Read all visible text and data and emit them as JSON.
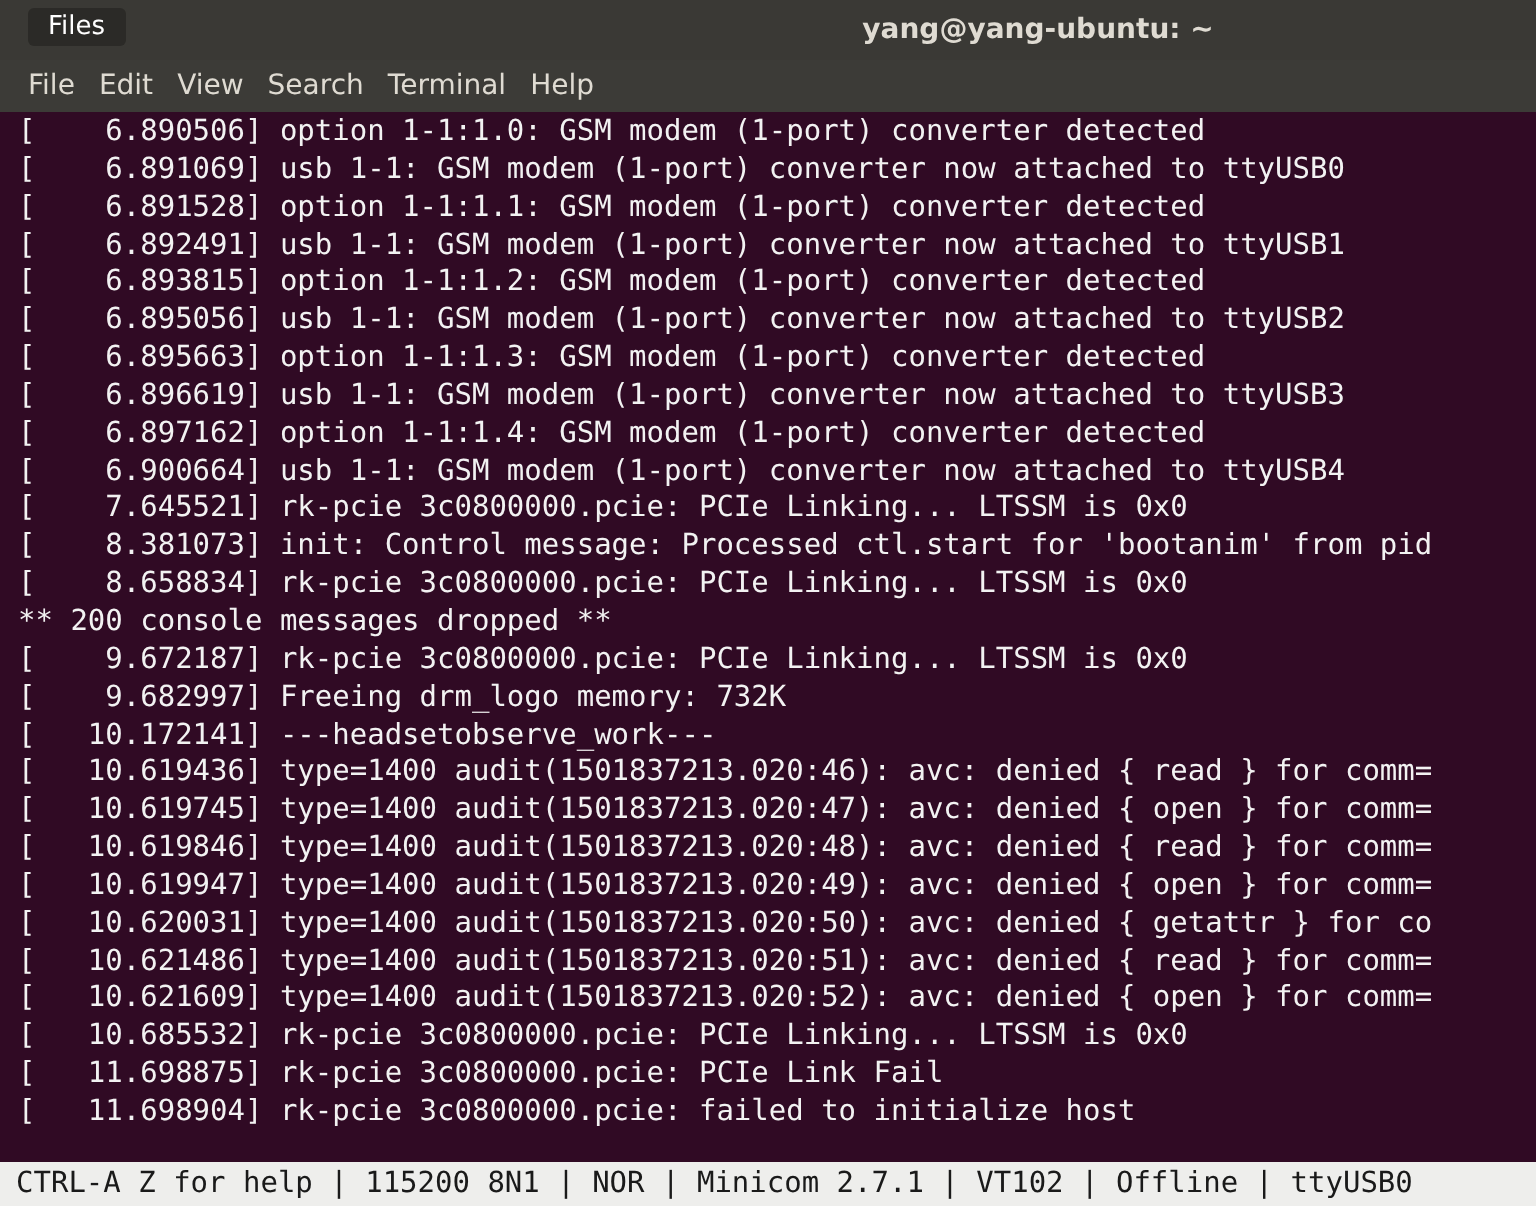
{
  "window": {
    "title": "yang@yang-ubuntu: ~"
  },
  "menu": [
    "File",
    "Edit",
    "View",
    "Search",
    "Terminal",
    "Help"
  ],
  "tooltip": "Files",
  "terminal_lines": [
    "[    6.890506] option 1-1:1.0: GSM modem (1-port) converter detected",
    "[    6.891069] usb 1-1: GSM modem (1-port) converter now attached to ttyUSB0",
    "[    6.891528] option 1-1:1.1: GSM modem (1-port) converter detected",
    "[    6.892491] usb 1-1: GSM modem (1-port) converter now attached to ttyUSB1",
    "[    6.893815] option 1-1:1.2: GSM modem (1-port) converter detected",
    "[    6.895056] usb 1-1: GSM modem (1-port) converter now attached to ttyUSB2",
    "[    6.895663] option 1-1:1.3: GSM modem (1-port) converter detected",
    "[    6.896619] usb 1-1: GSM modem (1-port) converter now attached to ttyUSB3",
    "[    6.897162] option 1-1:1.4: GSM modem (1-port) converter detected",
    "[    6.900664] usb 1-1: GSM modem (1-port) converter now attached to ttyUSB4",
    "[    7.645521] rk-pcie 3c0800000.pcie: PCIe Linking... LTSSM is 0x0",
    "[    8.381073] init: Control message: Processed ctl.start for 'bootanim' from pid",
    "[    8.658834] rk-pcie 3c0800000.pcie: PCIe Linking... LTSSM is 0x0",
    "** 200 console messages dropped **",
    "[    9.672187] rk-pcie 3c0800000.pcie: PCIe Linking... LTSSM is 0x0",
    "[    9.682997] Freeing drm_logo memory: 732K",
    "[   10.172141] ---headsetobserve_work---",
    "[   10.619436] type=1400 audit(1501837213.020:46): avc: denied { read } for comm=",
    "[   10.619745] type=1400 audit(1501837213.020:47): avc: denied { open } for comm=",
    "[   10.619846] type=1400 audit(1501837213.020:48): avc: denied { read } for comm=",
    "[   10.619947] type=1400 audit(1501837213.020:49): avc: denied { open } for comm=",
    "[   10.620031] type=1400 audit(1501837213.020:50): avc: denied { getattr } for co",
    "[   10.621486] type=1400 audit(1501837213.020:51): avc: denied { read } for comm=",
    "[   10.621609] type=1400 audit(1501837213.020:52): avc: denied { open } for comm=",
    "[   10.685532] rk-pcie 3c0800000.pcie: PCIe Linking... LTSSM is 0x0",
    "[   11.698875] rk-pcie 3c0800000.pcie: PCIe Link Fail",
    "[   11.698904] rk-pcie 3c0800000.pcie: failed to initialize host"
  ],
  "status_bar": "CTRL-A Z for help | 115200 8N1 | NOR | Minicom 2.7.1 | VT102 | Offline | ttyUSB0"
}
